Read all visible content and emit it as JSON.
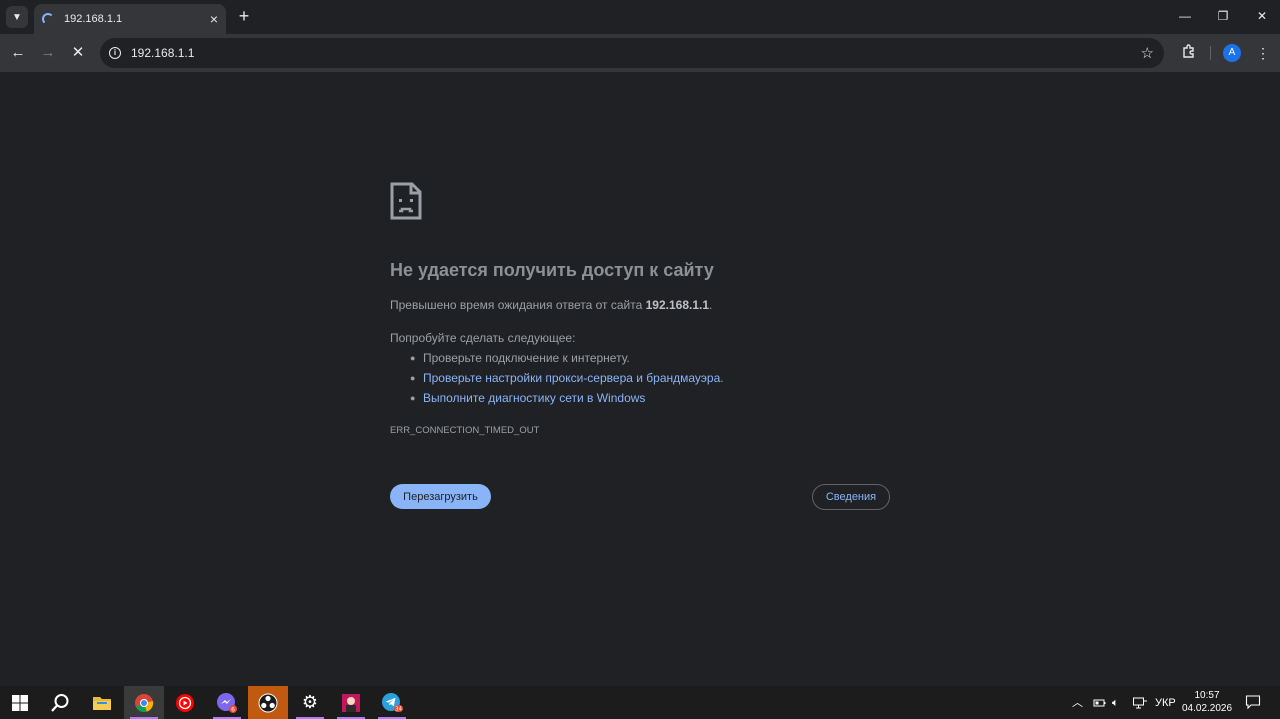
{
  "browser": {
    "tab": {
      "title": "192.168.1.1"
    },
    "new_tab_icon": "+",
    "window": {
      "minimize": "—",
      "maximize": "❐",
      "close": "✕"
    },
    "toolbar": {
      "back": "←",
      "forward": "→",
      "stop": "✕",
      "url": "192.168.1.1",
      "avatar_letter": "A"
    }
  },
  "error_page": {
    "title": "Не удается получить доступ к сайту",
    "description_prefix": "Превышено время ожидания ответа от сайта ",
    "host": "192.168.1.1",
    "description_suffix": ".",
    "try_label": "Попробуйте сделать следующее:",
    "suggestions": [
      {
        "text": "Проверьте подключение к интернету.",
        "link": false
      },
      {
        "text": "Проверьте настройки прокси-сервера и брандмауэра.",
        "link": true
      },
      {
        "text": "Выполните диагностику сети в Windows",
        "link": true
      }
    ],
    "error_code": "ERR_CONNECTION_TIMED_OUT",
    "reload_button": "Перезагрузить",
    "details_button": "Сведения"
  },
  "taskbar": {
    "apps": [
      {
        "name": "start-icon"
      },
      {
        "name": "search-icon"
      },
      {
        "name": "file-explorer-icon"
      },
      {
        "name": "chrome-icon",
        "active": true
      },
      {
        "name": "youtube-music-icon"
      },
      {
        "name": "messenger-icon",
        "badge": "6"
      },
      {
        "name": "obs-icon"
      },
      {
        "name": "settings-icon"
      },
      {
        "name": "game-icon"
      },
      {
        "name": "telegram-icon",
        "badge": "34"
      }
    ],
    "tray": {
      "language": "УКР",
      "time": "10:57",
      "date": "04.02.2026"
    }
  },
  "colors": {
    "background": "#202124",
    "toolbar": "#35363a",
    "link": "#8ab4f8",
    "primary_button": "#8ab4f8"
  }
}
